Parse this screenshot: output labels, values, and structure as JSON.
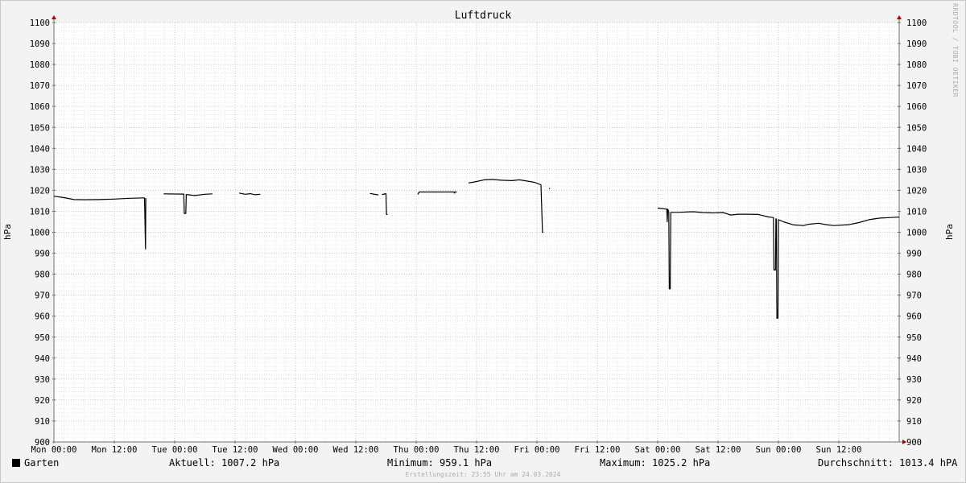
{
  "chart_data": {
    "type": "line",
    "title": "Luftdruck",
    "ylabel_left": "hPa",
    "ylabel_right": "hPa",
    "ylim": [
      900,
      1100
    ],
    "y_ticks": [
      900,
      910,
      920,
      930,
      940,
      950,
      960,
      970,
      980,
      990,
      1000,
      1010,
      1020,
      1030,
      1040,
      1050,
      1060,
      1070,
      1080,
      1090,
      1100
    ],
    "x_range_hours": [
      0,
      168
    ],
    "x_ticks": [
      {
        "h": 0,
        "label": "Mon 00:00"
      },
      {
        "h": 12,
        "label": "Mon 12:00"
      },
      {
        "h": 24,
        "label": "Tue 00:00"
      },
      {
        "h": 36,
        "label": "Tue 12:00"
      },
      {
        "h": 48,
        "label": "Wed 00:00"
      },
      {
        "h": 60,
        "label": "Wed 12:00"
      },
      {
        "h": 72,
        "label": "Thu 00:00"
      },
      {
        "h": 84,
        "label": "Thu 12:00"
      },
      {
        "h": 96,
        "label": "Fri 00:00"
      },
      {
        "h": 108,
        "label": "Fri 12:00"
      },
      {
        "h": 120,
        "label": "Sat 00:00"
      },
      {
        "h": 132,
        "label": "Sat 12:00"
      },
      {
        "h": 144,
        "label": "Sun 00:00"
      },
      {
        "h": 156,
        "label": "Sun 12:00"
      }
    ],
    "series": [
      {
        "name": "Garten",
        "color": "#000000",
        "segments": [
          [
            [
              0,
              1017.2
            ],
            [
              2,
              1016.5
            ],
            [
              4,
              1015.6
            ],
            [
              6,
              1015.5
            ],
            [
              9,
              1015.6
            ],
            [
              12,
              1015.8
            ],
            [
              15,
              1016.2
            ],
            [
              18,
              1016.4
            ],
            [
              18.2,
              992
            ],
            [
              18.25,
              1016.3
            ]
          ],
          [
            [
              21.8,
              1018.3
            ],
            [
              25.8,
              1018.2
            ],
            [
              25.9,
              1009
            ],
            [
              26.2,
              1009
            ],
            [
              26.3,
              1018
            ],
            [
              28,
              1017.5
            ],
            [
              30,
              1018.1
            ],
            [
              31.5,
              1018.3
            ]
          ],
          [
            [
              36.8,
              1018.7
            ],
            [
              38,
              1018.1
            ],
            [
              39,
              1018.4
            ],
            [
              40,
              1017.9
            ],
            [
              41,
              1018.1
            ]
          ],
          [
            [
              62.8,
              1018.5
            ],
            [
              64.5,
              1017.8
            ]
          ],
          [
            [
              65.2,
              1018
            ],
            [
              66,
              1018.4
            ],
            [
              66.1,
              1008.5
            ],
            [
              66.3,
              1008.5
            ]
          ],
          [
            [
              72.3,
              1018
            ],
            [
              72.6,
              1019.2
            ],
            [
              80,
              1019.2
            ],
            [
              79.5,
              1019.2
            ],
            [
              79.7,
              1018.5
            ]
          ],
          [
            [
              82.4,
              1023.5
            ],
            [
              84,
              1024.2
            ],
            [
              85.5,
              1025
            ],
            [
              87,
              1025.2
            ],
            [
              89,
              1024.8
            ],
            [
              91,
              1024.6
            ],
            [
              92.5,
              1025
            ],
            [
              94,
              1024.4
            ],
            [
              95.5,
              1023.8
            ],
            [
              96.8,
              1022.6
            ],
            [
              97.1,
              1000
            ],
            [
              97.3,
              1000
            ]
          ],
          [
            [
              98.4,
              1020.8
            ],
            [
              98.6,
              1020.8
            ]
          ],
          [
            [
              120,
              1011.5
            ],
            [
              121.8,
              1011
            ],
            [
              121.9,
              1005
            ],
            [
              122,
              1011
            ],
            [
              122.2,
              1009.8
            ],
            [
              122.3,
              973
            ],
            [
              122.5,
              973
            ],
            [
              122.6,
              1009.5
            ],
            [
              124,
              1009.5
            ],
            [
              127,
              1009.8
            ],
            [
              129,
              1009.4
            ],
            [
              131,
              1009.2
            ],
            [
              133,
              1009.4
            ],
            [
              134.5,
              1008.2
            ],
            [
              136,
              1008.6
            ],
            [
              138,
              1008.6
            ],
            [
              140,
              1008.5
            ],
            [
              142,
              1007.3
            ],
            [
              143,
              1007
            ],
            [
              143.1,
              982
            ],
            [
              143.4,
              982
            ],
            [
              143.5,
              1006.5
            ],
            [
              143.6,
              1006
            ],
            [
              143.7,
              959
            ],
            [
              143.9,
              959
            ],
            [
              144,
              1006
            ],
            [
              145,
              1005
            ],
            [
              147,
              1003.5
            ],
            [
              149,
              1003.2
            ],
            [
              150,
              1003.8
            ],
            [
              152,
              1004.3
            ],
            [
              153.5,
              1003.6
            ],
            [
              155,
              1003.2
            ],
            [
              158,
              1003.6
            ],
            [
              160,
              1004.6
            ],
            [
              162,
              1006
            ],
            [
              164,
              1006.7
            ],
            [
              166,
              1007
            ],
            [
              168,
              1007.2
            ]
          ]
        ]
      }
    ]
  },
  "legend": {
    "series_name": "Garten",
    "current": "Aktuell: 1007.2 hPa",
    "minimum": "Minimum: 959.1 hPa",
    "maximum": "Maximum: 1025.2 hPa",
    "average": "Durchschnitt: 1013.4 hPA"
  },
  "footer": "Erstellungszeit: 23:55 Uhr am 24.03.2024",
  "watermark": "RRDTOOL / TOBI OETIKER",
  "colors": {
    "background": "#f3f3f3",
    "plot_background": "#ffffff",
    "minor_grid": "#d8d8d8",
    "major_grid": "#e8a0a0",
    "axis": "#707070",
    "arrow": "#aa0000",
    "line": "#000000"
  }
}
